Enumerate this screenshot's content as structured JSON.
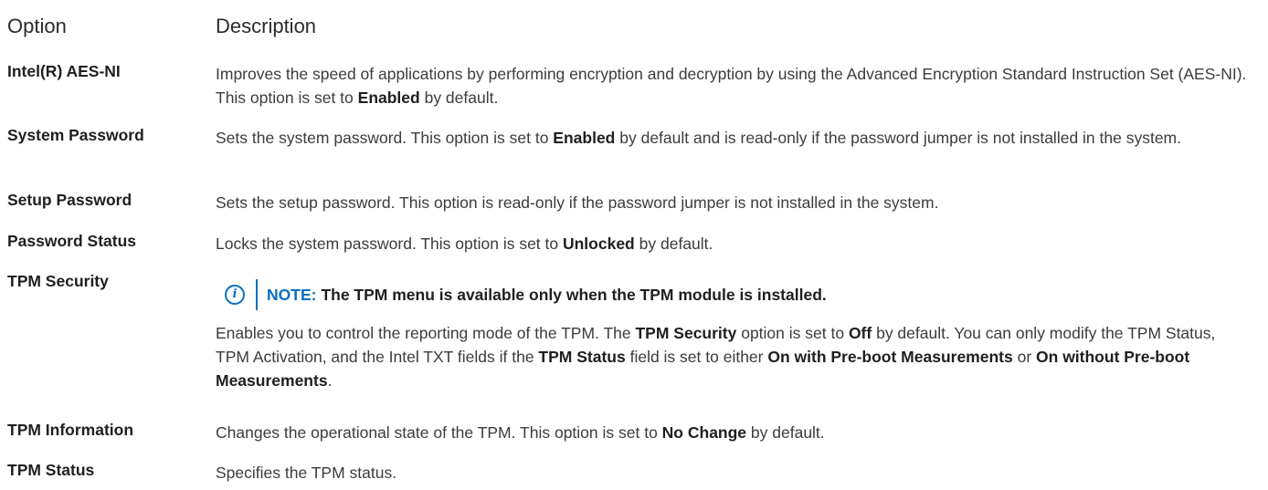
{
  "header": {
    "col_option": "Option",
    "col_description": "Description"
  },
  "rows": [
    {
      "term": "Intel(R) AES-NI",
      "description": [
        {
          "t": "Improves the speed of applications by performing encryption and decryption by using the Advanced Encryption Standard Instruction Set (AES-NI). This option is set to "
        },
        {
          "b": "Enabled"
        },
        {
          "t": " by default."
        }
      ]
    },
    {
      "term": "System Password",
      "description": [
        {
          "t": "Sets the system password. This option is set to "
        },
        {
          "b": "Enabled"
        },
        {
          "t": " by default and is read-only if the password jumper is not installed in the system."
        }
      ]
    },
    {
      "term": "Setup Password",
      "description": [
        {
          "t": "Sets the setup password. This option is read-only if the password jumper is not installed in the system."
        }
      ]
    },
    {
      "term": "Password Status",
      "description": [
        {
          "t": "Locks the system password. This option is set to "
        },
        {
          "b": "Unlocked"
        },
        {
          "t": " by default."
        }
      ]
    },
    {
      "term": "TPM Security",
      "note": {
        "label": "NOTE:",
        "text": "The TPM menu is available only when the TPM module is installed."
      },
      "description": [
        {
          "t": "Enables you to control the reporting mode of the TPM. The "
        },
        {
          "b": "TPM Security"
        },
        {
          "t": " option is set to "
        },
        {
          "b": "Off"
        },
        {
          "t": " by default. You can only modify the TPM Status, TPM Activation, and the Intel TXT fields if the "
        },
        {
          "b": "TPM Status"
        },
        {
          "t": " field is set to either "
        },
        {
          "b": "On with Pre-boot Measurements"
        },
        {
          "t": " or "
        },
        {
          "b": "On without Pre-boot Measurements"
        },
        {
          "t": "."
        }
      ]
    },
    {
      "term": "TPM Information",
      "description": [
        {
          "t": "Changes the operational state of the TPM. This option is set to "
        },
        {
          "b": "No Change"
        },
        {
          "t": " by default."
        }
      ]
    },
    {
      "term": "TPM Status",
      "description": [
        {
          "t": "Specifies the TPM status."
        }
      ]
    }
  ],
  "colors": {
    "note_accent": "#0a6fbf",
    "text": "#3c3c3c",
    "term": "#1f1f1f"
  },
  "icons": {
    "note_icon": "info-icon"
  }
}
